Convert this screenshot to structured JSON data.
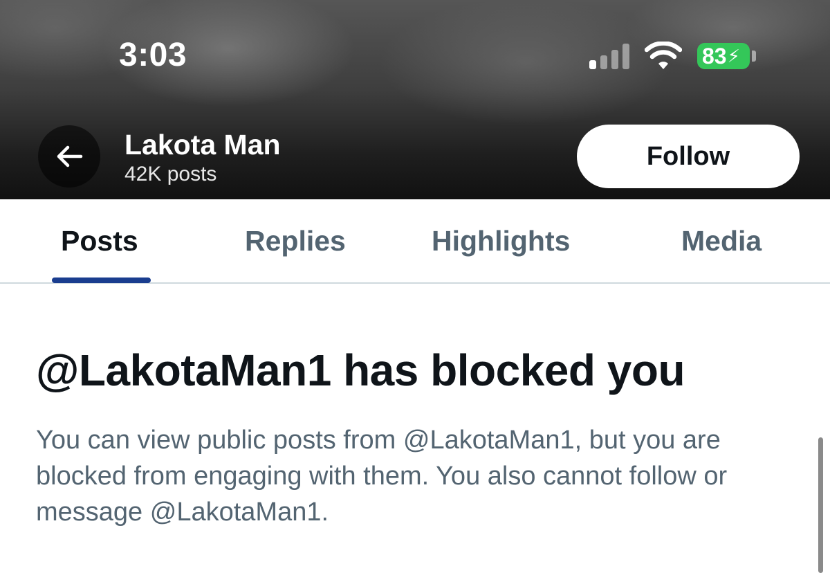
{
  "status_bar": {
    "time": "3:03",
    "battery_level": "83",
    "battery_color": "#34c759",
    "signal_icon": "cellular-signal-icon",
    "wifi_icon": "wifi-icon",
    "charging_icon": "charging-bolt-icon"
  },
  "header": {
    "back_icon": "arrow-left-icon",
    "profile_name": "Lakota Man",
    "post_count": "42K posts",
    "follow_label": "Follow"
  },
  "tabs": [
    {
      "label": "Posts",
      "active": true
    },
    {
      "label": "Replies",
      "active": false
    },
    {
      "label": "Highlights",
      "active": false
    },
    {
      "label": "Media",
      "active": false
    }
  ],
  "blocked_notice": {
    "title": "@LakotaMan1 has blocked you",
    "message": "You can view public posts from @LakotaMan1, but you are blocked from engaging with them. You also cannot follow or message @LakotaMan1."
  },
  "colors": {
    "tab_indicator": "#1a3d8f",
    "primary_text": "#0f1419",
    "secondary_text": "#536471"
  }
}
